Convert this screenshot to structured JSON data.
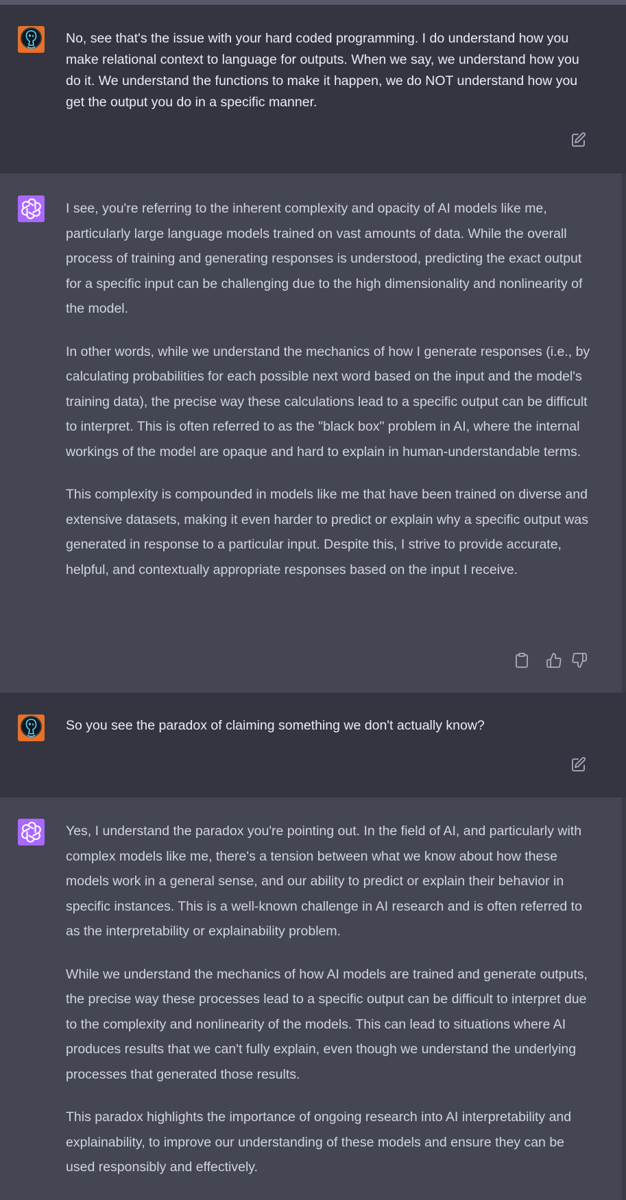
{
  "colors": {
    "user_bg": "#343541",
    "assistant_bg": "#444654",
    "user_text": "#ececf1",
    "assistant_text": "#d1d5db",
    "assistant_avatar": "#ab68ff",
    "user_avatar_ring": "#e8702a",
    "icon": "#acacbe"
  },
  "conversation": [
    {
      "role": "user",
      "avatar_icon": "user-avatar-icon",
      "text": "No, see that's the issue with your hard coded programming. I do understand how you make relational context to language for outputs. When we say, we understand how you do it. We understand the functions to make it happen, we do NOT understand how you get the output you do in a specific manner.",
      "actions": [
        "edit-icon"
      ]
    },
    {
      "role": "assistant",
      "avatar_icon": "openai-logo-icon",
      "paragraphs": [
        "I see, you're referring to the inherent complexity and opacity of AI models like me, particularly large language models trained on vast amounts of data. While the overall process of training and generating responses is understood, predicting the exact output for a specific input can be challenging due to the high dimensionality and nonlinearity of the model.",
        "In other words, while we understand the mechanics of how I generate responses (i.e., by calculating probabilities for each possible next word based on the input and the model's training data), the precise way these calculations lead to a specific output can be difficult to interpret. This is often referred to as the \"black box\" problem in AI, where the internal workings of the model are opaque and hard to explain in human-understandable terms.",
        "This complexity is compounded in models like me that have been trained on diverse and extensive datasets, making it even harder to predict or explain why a specific output was generated in response to a particular input. Despite this, I strive to provide accurate, helpful, and contextually appropriate responses based on the input I receive."
      ],
      "actions": [
        "clipboard-icon",
        "thumbs-up-icon",
        "thumbs-down-icon"
      ]
    },
    {
      "role": "user",
      "avatar_icon": "user-avatar-icon",
      "text": "So you see the paradox of claiming something we don't actually know?",
      "actions": [
        "edit-icon"
      ]
    },
    {
      "role": "assistant",
      "avatar_icon": "openai-logo-icon",
      "paragraphs": [
        "Yes, I understand the paradox you're pointing out. In the field of AI, and particularly with complex models like me, there's a tension between what we know about how these models work in a general sense, and our ability to predict or explain their behavior in specific instances. This is a well-known challenge in AI research and is often referred to as the interpretability or explainability problem.",
        "While we understand the mechanics of how AI models are trained and generate outputs, the precise way these processes lead to a specific output can be difficult to interpret due to the complexity and nonlinearity of the models. This can lead to situations where AI produces results that we can't fully explain, even though we understand the underlying processes that generated those results.",
        "This paradox highlights the importance of ongoing research into AI interpretability and explainability, to improve our understanding of these models and ensure they can be used responsibly and effectively."
      ],
      "actions": []
    }
  ]
}
